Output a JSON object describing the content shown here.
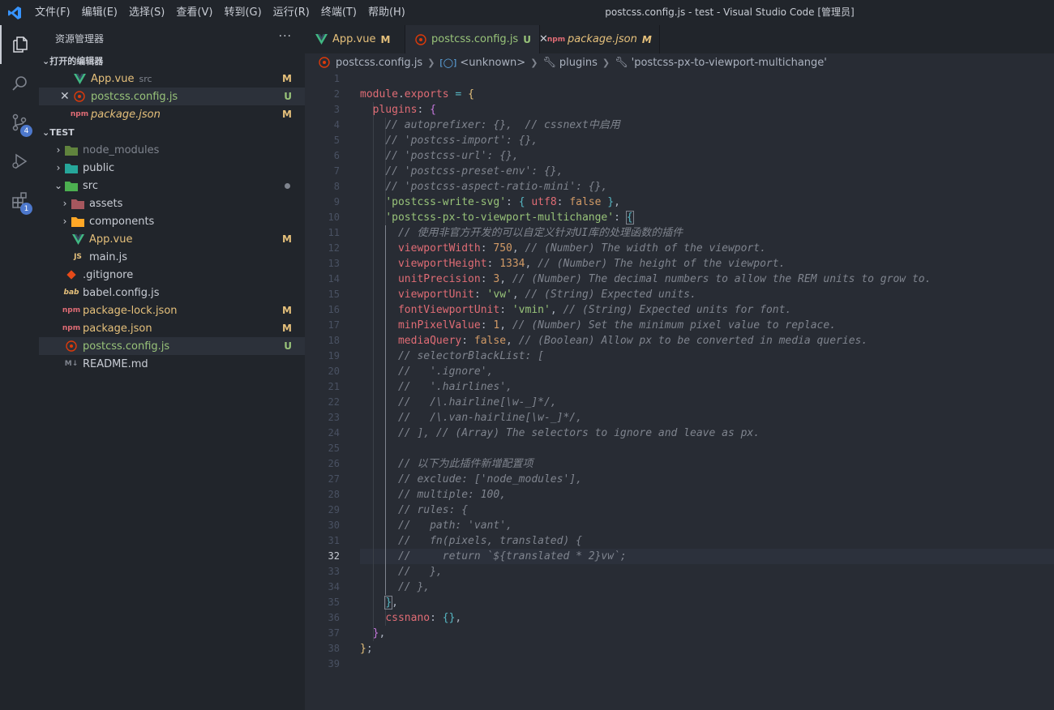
{
  "titlebar": {
    "menu": [
      "文件(F)",
      "编辑(E)",
      "选择(S)",
      "查看(V)",
      "转到(G)",
      "运行(R)",
      "终端(T)",
      "帮助(H)"
    ],
    "title": "postcss.config.js - test - Visual Studio Code [管理员]"
  },
  "activity": {
    "scm_badge": "4",
    "ext_badge": "1"
  },
  "sidebar": {
    "title": "资源管理器",
    "more": "···",
    "open_editors_label": "打开的编辑器",
    "open_editors": [
      {
        "name": "App.vue",
        "desc": "src",
        "status": "M"
      },
      {
        "name": "postcss.config.js",
        "desc": "",
        "status": "U"
      },
      {
        "name": "package.json",
        "desc": "",
        "status": "M"
      }
    ],
    "folder_label": "TEST",
    "tree": [
      {
        "name": "node_modules"
      },
      {
        "name": "public"
      },
      {
        "name": "src"
      },
      {
        "name": "assets"
      },
      {
        "name": "components"
      },
      {
        "name": "App.vue",
        "status": "M"
      },
      {
        "name": "main.js"
      },
      {
        "name": ".gitignore"
      },
      {
        "name": "babel.config.js"
      },
      {
        "name": "package-lock.json",
        "status": "M"
      },
      {
        "name": "package.json",
        "status": "M"
      },
      {
        "name": "postcss.config.js",
        "status": "U"
      },
      {
        "name": "README.md"
      }
    ]
  },
  "tabs": [
    {
      "label": "App.vue",
      "status": "M"
    },
    {
      "label": "postcss.config.js",
      "status": "U"
    },
    {
      "label": "package.json",
      "status": "M"
    }
  ],
  "breadcrumb": [
    "postcss.config.js",
    "<unknown>",
    "plugins",
    "'postcss-px-to-viewport-multichange'"
  ],
  "editor": {
    "current_line": 32,
    "line_numbers": [
      "1",
      "2",
      "3",
      "4",
      "5",
      "6",
      "7",
      "8",
      "9",
      "10",
      "11",
      "12",
      "13",
      "14",
      "15",
      "16",
      "17",
      "18",
      "19",
      "20",
      "21",
      "22",
      "23",
      "24",
      "25",
      "26",
      "27",
      "28",
      "29",
      "30",
      "31",
      "32",
      "33",
      "34",
      "35",
      "36",
      "37",
      "38",
      "39"
    ]
  },
  "colors": {
    "accent": "#4d78cc",
    "modified": "#e5c07b",
    "untracked": "#98c379",
    "bg": "#282c34",
    "sidebar": "#21252b"
  }
}
